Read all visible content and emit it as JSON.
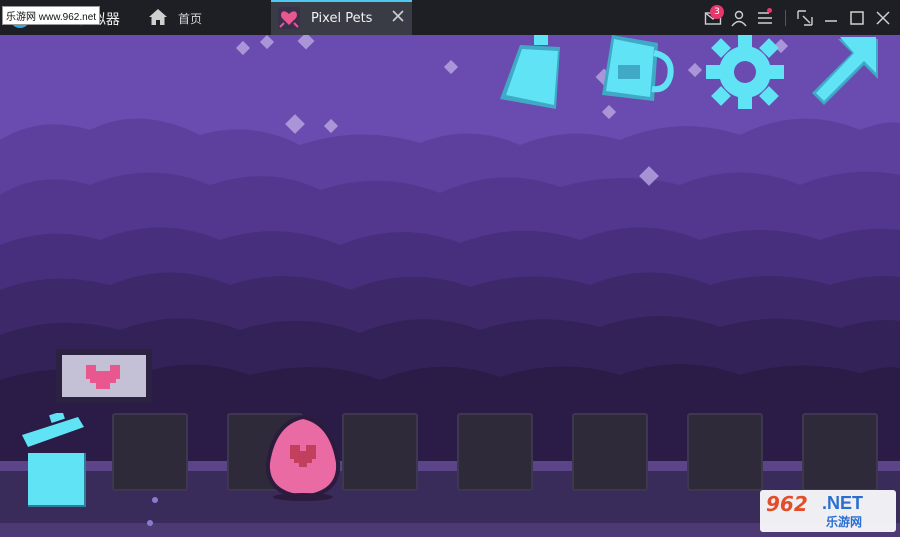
{
  "titlebar": {
    "watermark": "乐游网 www.962.net",
    "app_name": "MuMu模拟器",
    "home_label": "首页",
    "game_tab_label": "Pixel Pets",
    "mail_badge": "3"
  },
  "game": {
    "buttons": [
      "food-bottle",
      "drink-mug",
      "settings-gear",
      "expand-arrow"
    ],
    "accent_color": "#5fe3f5",
    "bg_color": "#6a4bb0",
    "slot_count": 7
  },
  "watermark": {
    "number": "962",
    "suffix": ".NET",
    "cn": "乐游网"
  }
}
